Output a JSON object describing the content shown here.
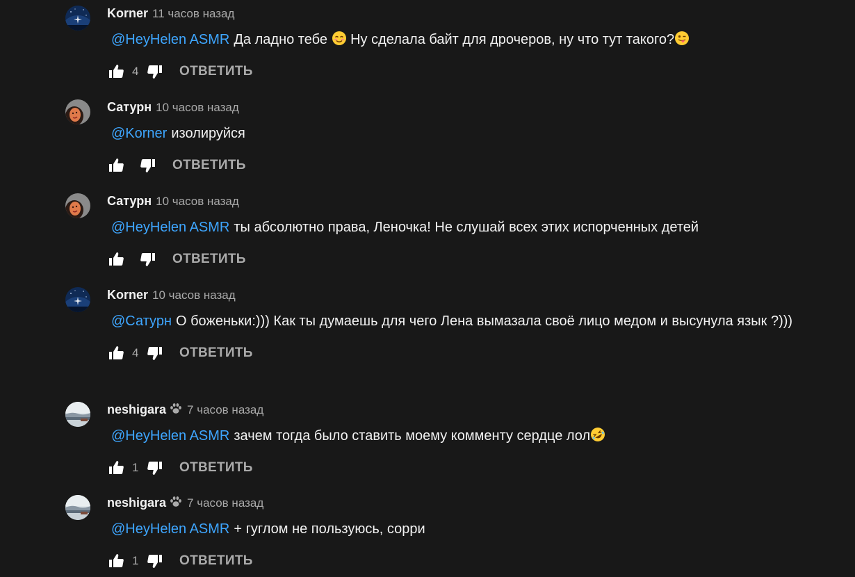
{
  "reply_label": "ОТВЕТИТЬ",
  "colors": {
    "background": "#181818",
    "text": "#f1f1f1",
    "secondary": "#aaaaaa",
    "mention": "#3ea6ff"
  },
  "comments": [
    {
      "author": "Korner",
      "time": "11 часов назад",
      "avatar": "night-sky-avatar",
      "mention": "@HeyHelen ASMR",
      "text": "Да ладно тебе",
      "emoji1": "smiling-face-with-smiling-eyes-emoji",
      "text2": "Ну сделала байт для дрочеров, ну что тут такого?",
      "emoji2": "winking-face-with-tongue-emoji",
      "likes": "4"
    },
    {
      "author": "Сатурн",
      "time": "10 часов назад",
      "avatar": "portrait-avatar",
      "mention": "@Korner",
      "text": "изолируйся",
      "likes": ""
    },
    {
      "author": "Сатурн",
      "time": "10 часов назад",
      "avatar": "portrait-avatar",
      "mention": "@HeyHelen ASMR",
      "text": "ты абсолютно права, Леночка! Не слушай всех этих испорченных детей",
      "likes": ""
    },
    {
      "author": "Korner",
      "time": "10 часов назад",
      "avatar": "night-sky-avatar",
      "mention": "@Сатурн",
      "text": "О боженьки:))) Как ты думаешь для чего Лена вымазала своё лицо медом и высунула язык ?)))",
      "likes": "4"
    },
    {
      "author": "neshigara",
      "time": "7 часов назад",
      "avatar": "landscape-avatar",
      "badge": "paw-icon",
      "mention": "@HeyHelen ASMR",
      "text": "зачем тогда было ставить моему комменту сердце лол",
      "emoji1": "rolling-on-floor-laughing-emoji",
      "likes": "1"
    },
    {
      "author": "neshigara",
      "time": "7 часов назад",
      "avatar": "landscape-avatar",
      "badge": "paw-icon",
      "mention": "@HeyHelen ASMR",
      "text": "+ гуглом не пользуюсь, сорри",
      "likes": "1"
    }
  ]
}
